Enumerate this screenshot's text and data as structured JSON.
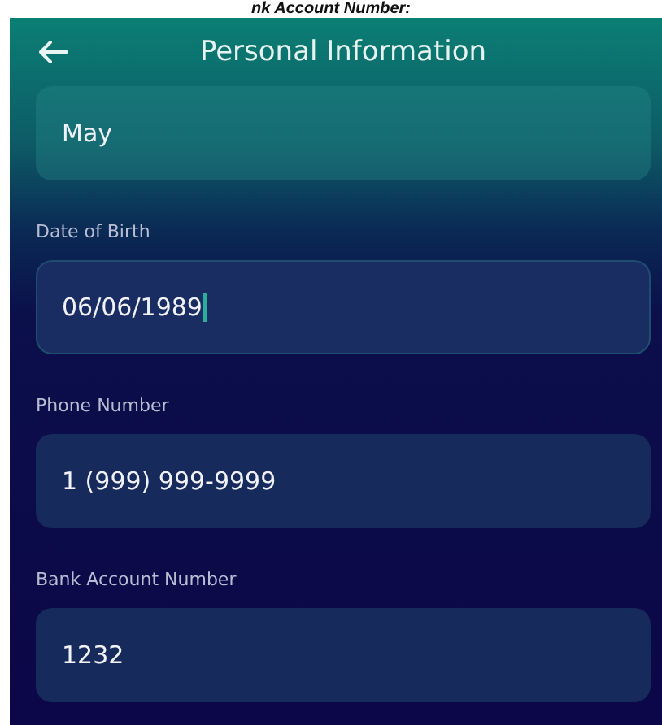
{
  "caption": "nk Account Number:",
  "header": {
    "title": "Personal Information"
  },
  "fields": [
    {
      "value": "May",
      "focused": false
    },
    {
      "label": "Date of Birth",
      "value": "06/06/1989",
      "focused": true
    },
    {
      "label": "Phone Number",
      "value": "1 (999) 999-9999",
      "focused": false
    },
    {
      "label": "Bank Account Number",
      "value": "1232",
      "focused": false
    }
  ]
}
